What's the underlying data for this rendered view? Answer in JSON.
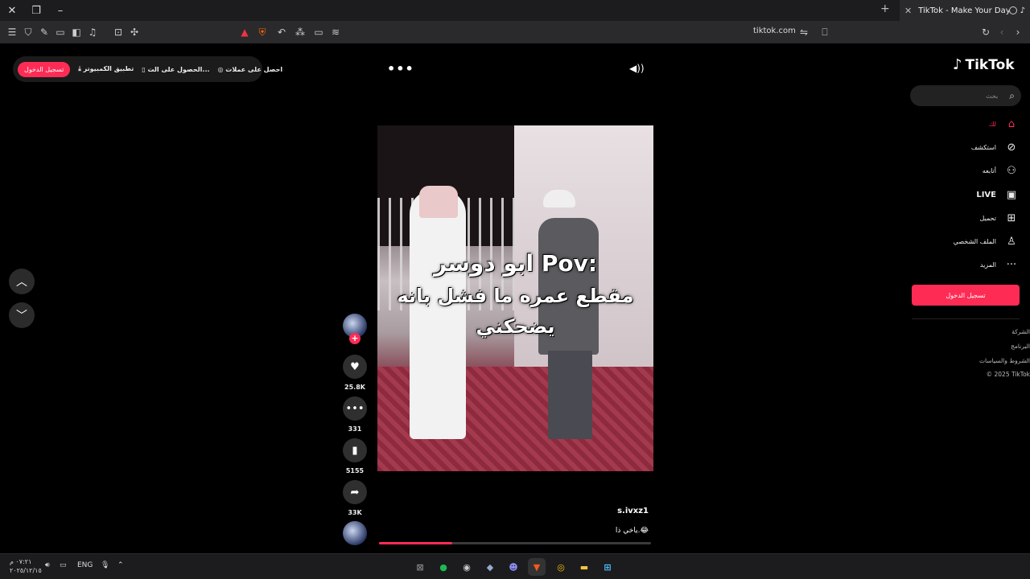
{
  "browser": {
    "tab_title": "TikTok - Make Your Day",
    "url": "tiktok.com"
  },
  "tiktok": {
    "logo_text": "TikTok",
    "promo": {
      "login": "تسجيل الدخول",
      "desktop_app": "تطبيق الكمبيوتر",
      "get_app": "الحصول على الت...",
      "get_coins": "احصل على عملات"
    },
    "search_placeholder": "بحث",
    "nav": [
      {
        "label": "لك",
        "icon": "home-icon"
      },
      {
        "label": "استكشف",
        "icon": "compass-icon"
      },
      {
        "label": "أتابعه",
        "icon": "following-icon"
      },
      {
        "label": "LIVE",
        "icon": "live-icon"
      },
      {
        "label": "تحميل",
        "icon": "upload-icon"
      },
      {
        "label": "الملف الشخصي",
        "icon": "profile-icon"
      },
      {
        "label": "المزيد",
        "icon": "more-icon"
      }
    ],
    "sidebar_login": "تسجيل الدخول",
    "footer": [
      "الشركة",
      "البرنامج",
      "الشروط والسياسات",
      "© 2025 TikTok"
    ],
    "video": {
      "caption_line1": "ابو دوسر  Pov:",
      "caption_line2": "مقطع عمره ما فشل بانه",
      "caption_line3": "يضحكني",
      "author": "s.ivxz1",
      "description": "ياخي ذا.😂",
      "progress": 0.27
    },
    "actions": {
      "likes": "25.8K",
      "comments": "331",
      "saves": "5155",
      "shares": "33K"
    }
  },
  "taskbar": {
    "time": "٠٧:٢١ م",
    "date": "٢٠٢٥/١٢/١٥",
    "lang": "ENG"
  }
}
